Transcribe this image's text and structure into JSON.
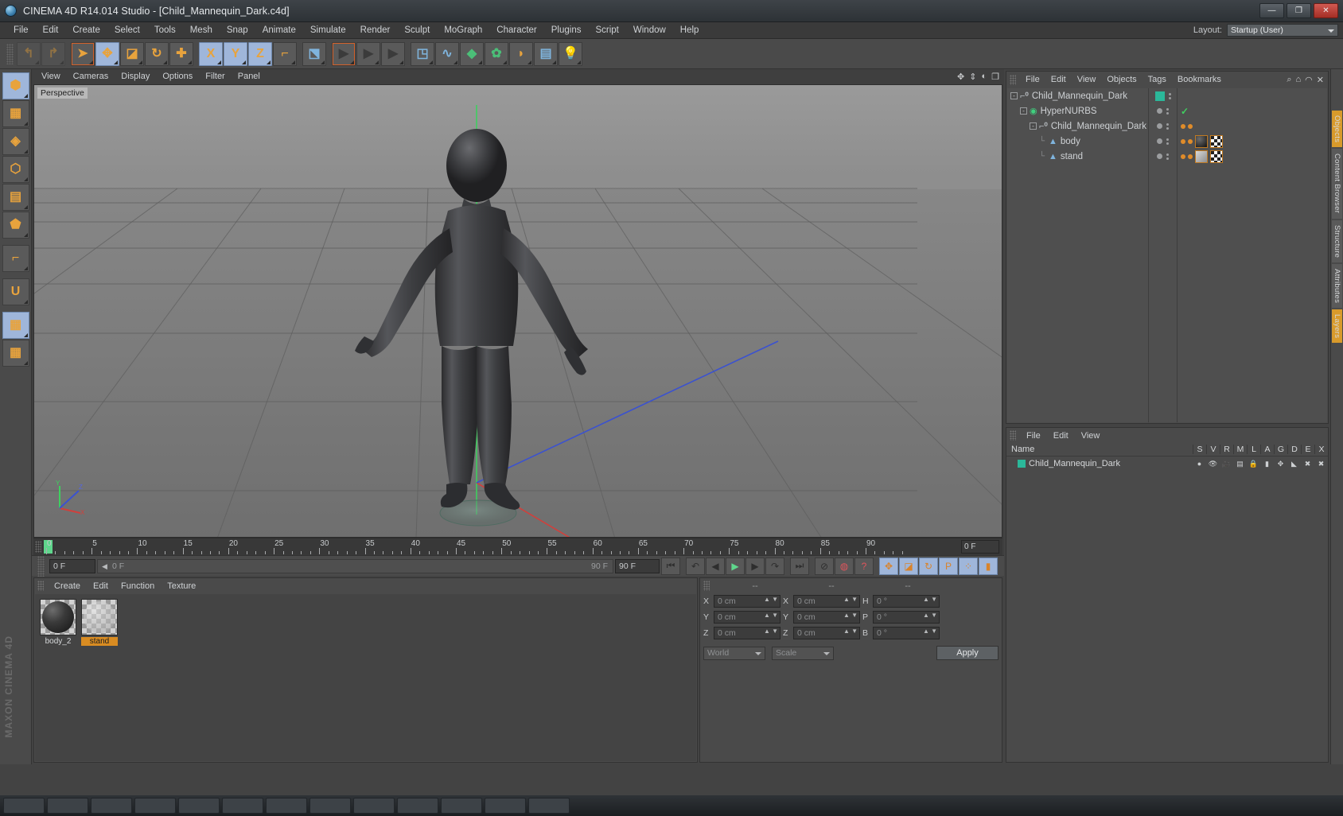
{
  "window": {
    "title": "CINEMA 4D R14.014 Studio - [Child_Mannequin_Dark.c4d]",
    "logo_icon": "cinema4d-logo-icon",
    "minimize_label": "—",
    "maximize_label": "❐",
    "close_label": "✕"
  },
  "menubar": {
    "items": [
      "File",
      "Edit",
      "Create",
      "Select",
      "Tools",
      "Mesh",
      "Snap",
      "Animate",
      "Simulate",
      "Render",
      "Sculpt",
      "MoGraph",
      "Character",
      "Plugins",
      "Script",
      "Window",
      "Help"
    ],
    "layout_label": "Layout:",
    "layout_value": "Startup (User)"
  },
  "toolbar": {
    "groups": [
      {
        "name": "undo-redo",
        "buttons": [
          {
            "name": "undo-button",
            "icon": "undo-icon",
            "glyph": "↰",
            "state": "disabled",
            "selected": false
          },
          {
            "name": "redo-button",
            "icon": "redo-icon",
            "glyph": "↱",
            "state": "disabled",
            "selected": false
          }
        ]
      },
      {
        "name": "transform-tools",
        "buttons": [
          {
            "name": "select-tool",
            "icon": "cursor-arrow-icon",
            "glyph": "➤",
            "state": "active-ring",
            "selected": false
          },
          {
            "name": "move-tool",
            "icon": "move-arrows-icon",
            "glyph": "✥",
            "state": "normal",
            "selected": true
          },
          {
            "name": "scale-tool",
            "icon": "scale-box-icon",
            "glyph": "◪",
            "state": "normal",
            "selected": false
          },
          {
            "name": "rotate-tool",
            "icon": "rotate-circle-icon",
            "glyph": "↻",
            "state": "normal",
            "selected": false
          },
          {
            "name": "add-tool",
            "icon": "plus-icon",
            "glyph": "✚",
            "state": "normal",
            "selected": false
          }
        ]
      },
      {
        "name": "axis-locks",
        "buttons": [
          {
            "name": "lock-x-axis",
            "icon": "axis-x-icon",
            "glyph": "X",
            "state": "normal",
            "selected": true
          },
          {
            "name": "lock-y-axis",
            "icon": "axis-y-icon",
            "glyph": "Y",
            "state": "normal",
            "selected": true
          },
          {
            "name": "lock-z-axis",
            "icon": "axis-z-icon",
            "glyph": "Z",
            "state": "normal",
            "selected": true
          },
          {
            "name": "world-object-coord",
            "icon": "world-coordinates-icon",
            "glyph": "⌐",
            "state": "normal",
            "selected": false
          }
        ]
      },
      {
        "name": "coordinate-system",
        "buttons": [
          {
            "name": "coordinate-system-toggle",
            "icon": "axis-cube-icon",
            "glyph": "⬔",
            "state": "normal",
            "selected": false
          }
        ]
      },
      {
        "name": "render-tools",
        "buttons": [
          {
            "name": "render-view-button",
            "icon": "render-clapper-icon",
            "glyph": "▶",
            "state": "active-ring",
            "selected": false
          },
          {
            "name": "render-region-button",
            "icon": "render-region-icon",
            "glyph": "▶",
            "state": "normal",
            "selected": false
          },
          {
            "name": "render-settings-button",
            "icon": "render-settings-icon",
            "glyph": "▶",
            "state": "normal",
            "selected": false
          }
        ]
      },
      {
        "name": "create-objects",
        "buttons": [
          {
            "name": "add-cube-button",
            "icon": "cube-icon",
            "glyph": "◳",
            "state": "normal",
            "selected": false
          },
          {
            "name": "add-spline-button",
            "icon": "spline-icon",
            "glyph": "∿",
            "state": "normal",
            "selected": false
          },
          {
            "name": "add-generator-button",
            "icon": "nurbs-generator-icon",
            "glyph": "◆",
            "state": "normal",
            "selected": false
          },
          {
            "name": "add-deformer-button",
            "icon": "deformer-icon",
            "glyph": "✿",
            "state": "normal",
            "selected": false
          },
          {
            "name": "add-scene-button",
            "icon": "scene-object-icon",
            "glyph": "◗",
            "state": "normal",
            "selected": false
          },
          {
            "name": "add-camera-button",
            "icon": "camera-icon",
            "glyph": "▤",
            "state": "normal",
            "selected": false
          },
          {
            "name": "add-light-button",
            "icon": "light-bulb-icon",
            "glyph": "💡",
            "state": "normal",
            "selected": false
          }
        ]
      }
    ]
  },
  "left_toolbar": {
    "buttons": [
      {
        "name": "model-mode-button",
        "icon": "model-cube-icon",
        "glyph": "⬢",
        "selected": true
      },
      {
        "name": "texture-mode-button",
        "icon": "texture-checker-icon",
        "glyph": "▦",
        "selected": false
      },
      {
        "name": "polygon-grid-button",
        "icon": "polygon-mesh-icon",
        "glyph": "◈",
        "selected": false
      },
      {
        "name": "points-mode-button",
        "icon": "points-cube-icon",
        "glyph": "⬡",
        "selected": false
      },
      {
        "name": "edges-mode-button",
        "icon": "edges-cube-icon",
        "glyph": "▤",
        "selected": false
      },
      {
        "name": "polygons-mode-button",
        "icon": "polygons-cube-icon",
        "glyph": "⬟",
        "selected": false
      },
      {
        "name": "axis-mode-button",
        "icon": "axis-arrows-icon",
        "glyph": "⌐",
        "selected": false
      },
      {
        "name": "snap-magnet-button",
        "icon": "magnet-icon",
        "glyph": "U",
        "selected": false
      },
      {
        "name": "workplane-lock-button",
        "icon": "workplane-lock-icon",
        "glyph": "▦",
        "selected": true
      },
      {
        "name": "workplane-button",
        "icon": "workplane-icon",
        "glyph": "▦",
        "selected": false
      }
    ]
  },
  "viewport": {
    "menu": [
      "View",
      "Cameras",
      "Display",
      "Options",
      "Filter",
      "Panel"
    ],
    "label": "Perspective",
    "axis_labels": {
      "x": "X",
      "y": "Y",
      "z": "Z"
    },
    "corner_icons": [
      "move-viewport-icon",
      "pan-viewport-icon",
      "rotate-viewport-icon",
      "maximize-viewport-icon"
    ]
  },
  "timeline": {
    "ticks": [
      0,
      5,
      10,
      15,
      20,
      25,
      30,
      35,
      40,
      45,
      50,
      55,
      60,
      65,
      70,
      75,
      80,
      85,
      90
    ],
    "current_frame_field": "0 F",
    "start_frame_field": "0 F",
    "slider_value": "0 F",
    "slider_end": "90 F",
    "end_frame_field": "90 F",
    "playhead_frame": 0
  },
  "playback": {
    "buttons": [
      {
        "name": "go-to-start-button",
        "icon": "skip-start-icon",
        "glyph": "⏮",
        "selected": false
      },
      {
        "name": "previous-keyframe-button",
        "icon": "prev-key-icon",
        "glyph": "↶",
        "selected": false
      },
      {
        "name": "previous-frame-button",
        "icon": "step-back-icon",
        "glyph": "◀",
        "selected": false
      },
      {
        "name": "play-button",
        "icon": "play-icon",
        "glyph": "▶",
        "selected": false
      },
      {
        "name": "next-frame-button",
        "icon": "step-forward-icon",
        "glyph": "▶",
        "selected": false
      },
      {
        "name": "next-keyframe-button",
        "icon": "next-key-icon",
        "glyph": "↷",
        "selected": false
      },
      {
        "name": "go-to-end-button",
        "icon": "skip-end-icon",
        "glyph": "⏭",
        "selected": false
      },
      {
        "name": "record-active-objects-button",
        "icon": "record-disabled-icon",
        "glyph": "⊘",
        "selected": false
      },
      {
        "name": "autokeying-button",
        "icon": "autokey-icon",
        "glyph": "◍",
        "selected": false
      },
      {
        "name": "keyframe-selection-button",
        "icon": "question-icon",
        "glyph": "?",
        "selected": false
      },
      {
        "name": "position-key-button",
        "icon": "move-key-icon",
        "glyph": "✥",
        "selected": true
      },
      {
        "name": "scale-key-button",
        "icon": "scale-key-icon",
        "glyph": "◪",
        "selected": true
      },
      {
        "name": "rotation-key-button",
        "icon": "rotate-key-icon",
        "glyph": "↻",
        "selected": true
      },
      {
        "name": "param-key-button",
        "icon": "parameter-key-icon",
        "glyph": "P",
        "selected": true
      },
      {
        "name": "point-level-anim-button",
        "icon": "pla-icon",
        "glyph": "⁘",
        "selected": true
      },
      {
        "name": "timeline-view-button",
        "icon": "timeline-icon",
        "glyph": "▮",
        "selected": true
      }
    ]
  },
  "material_manager": {
    "menu": [
      "Create",
      "Edit",
      "Function",
      "Texture"
    ],
    "materials": [
      {
        "name": "body_2",
        "label": "body_2",
        "selected": false,
        "preview": "dark-sphere"
      },
      {
        "name": "stand",
        "label": "stand",
        "selected": true,
        "preview": "glass-sphere"
      }
    ]
  },
  "coordinate_manager": {
    "headers": [
      "--",
      "--",
      "--"
    ],
    "rows": [
      {
        "axis": "X",
        "position": "0 cm",
        "axis2": "X",
        "size": "0 cm",
        "rot_label": "H",
        "rotation": "0 °"
      },
      {
        "axis": "Y",
        "position": "0 cm",
        "axis2": "Y",
        "size": "0 cm",
        "rot_label": "P",
        "rotation": "0 °"
      },
      {
        "axis": "Z",
        "position": "0 cm",
        "axis2": "Z",
        "size": "0 cm",
        "rot_label": "B",
        "rotation": "0 °"
      }
    ],
    "coord_system": "World",
    "transform_mode": "Scale",
    "apply_label": "Apply"
  },
  "object_manager": {
    "menu": [
      "File",
      "Edit",
      "View",
      "Objects",
      "Tags",
      "Bookmarks"
    ],
    "right_icons": [
      "search-icon",
      "home-icon",
      "minimize-icon",
      "close-icon"
    ],
    "rows": [
      {
        "name": "Child_Mannequin_Dark",
        "indent": 0,
        "type": "null",
        "icon": "null-object-icon",
        "expanded": true,
        "layer_color": "#2bb89a",
        "check": false
      },
      {
        "name": "HyperNURBS",
        "indent": 1,
        "type": "hypernurbs",
        "icon": "hypernurbs-icon",
        "expanded": true,
        "layer_color": "",
        "check": true
      },
      {
        "name": "Child_Mannequin_Dark",
        "indent": 2,
        "type": "null",
        "icon": "null-object-icon",
        "expanded": true,
        "layer_color": "",
        "check": false
      },
      {
        "name": "body",
        "indent": 3,
        "type": "polygon",
        "icon": "polygon-object-icon",
        "expanded": false,
        "layer_color": "",
        "check": false
      },
      {
        "name": "stand",
        "indent": 3,
        "type": "polygon",
        "icon": "polygon-object-icon",
        "expanded": false,
        "layer_color": "",
        "check": false
      }
    ]
  },
  "layer_manager": {
    "menu": [
      "File",
      "Edit",
      "View"
    ],
    "columns": [
      "Name",
      "S",
      "V",
      "R",
      "M",
      "L",
      "A",
      "G",
      "D",
      "E",
      "X"
    ],
    "column_icons": [
      "solo-icon",
      "visible-eye-icon",
      "render-camera-icon",
      "manager-icon",
      "layers-icon",
      "animation-lock-icon",
      "generators-icon",
      "deformers-icon",
      "expressions-icon",
      "xpresso-icon"
    ],
    "rows": [
      {
        "name": "Child_Mannequin_Dark",
        "color": "#2bb89a"
      }
    ]
  },
  "edge_tabs": [
    {
      "name": "objects-tab",
      "label": "Objects",
      "accent": "#d89a2b"
    },
    {
      "name": "content-browser-tab",
      "label": "Content Browser",
      "accent": "#5a5a5a"
    },
    {
      "name": "structure-tab",
      "label": "Structure",
      "accent": "#5a5a5a"
    },
    {
      "name": "attributes-tab",
      "label": "Attributes",
      "accent": "#5a5a5a"
    },
    {
      "name": "layers-tab",
      "label": "Layers",
      "accent": "#d89a2b"
    }
  ],
  "branding": {
    "watermark": "MAXON CINEMA 4D"
  }
}
